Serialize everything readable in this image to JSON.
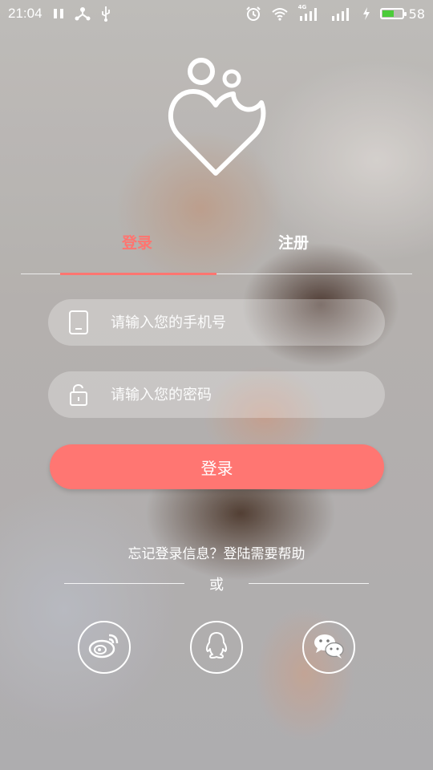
{
  "status_bar": {
    "time": "21:04",
    "battery_level": "58",
    "network_label": "4G",
    "icons": [
      "pause-icon",
      "share-network-icon",
      "usb-icon",
      "alarm-icon",
      "wifi-icon",
      "signal-icon",
      "charging-icon",
      "battery-icon"
    ]
  },
  "tabs": [
    {
      "label": "登录",
      "active": true
    },
    {
      "label": "注册",
      "active": false
    }
  ],
  "form": {
    "phone_placeholder": "请输入您的手机号",
    "password_placeholder": "请输入您的密码",
    "login_button": "登录"
  },
  "help": {
    "text": "忘记登录信息？登陆需要帮助"
  },
  "divider": {
    "label": "或"
  },
  "social": [
    "weibo-icon",
    "qq-icon",
    "wechat-icon"
  ],
  "colors": {
    "accent": "#ff7570",
    "battery_fill": "#4ccc3a"
  }
}
